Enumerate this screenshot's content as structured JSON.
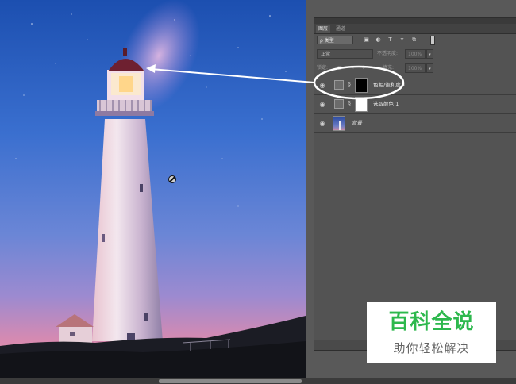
{
  "panel": {
    "tabs": [
      {
        "label": "图层",
        "active": true
      },
      {
        "label": "通道",
        "active": false
      }
    ],
    "filter": {
      "selected": "ρ 类型",
      "icons": [
        "image-filter-icon",
        "adjustment-filter-icon",
        "type-filter-icon",
        "shape-filter-icon",
        "smart-object-filter-icon"
      ]
    },
    "blend": {
      "mode": "正常",
      "opacity_label": "不透明度:",
      "opacity_value": "100%"
    },
    "lock": {
      "label": "锁定:",
      "icons": [
        "lock-transparent-icon",
        "lock-paint-icon",
        "lock-move-icon",
        "lock-all-icon"
      ],
      "fill_label": "填充:",
      "fill_value": "100%"
    },
    "layers": [
      {
        "name": "色相/饱和度 1",
        "visible": true,
        "type": "adjustment",
        "mask": "black"
      },
      {
        "name": "选取颜色 1",
        "visible": true,
        "type": "adjustment",
        "mask": "white"
      },
      {
        "name": "背景",
        "visible": true,
        "type": "background"
      }
    ]
  },
  "watermark": {
    "title": "百科全说",
    "subtitle": "助你轻松解决",
    "color": "#2db84d"
  },
  "colors": {
    "panel_bg": "#535353",
    "annotation": "#ffffff"
  }
}
